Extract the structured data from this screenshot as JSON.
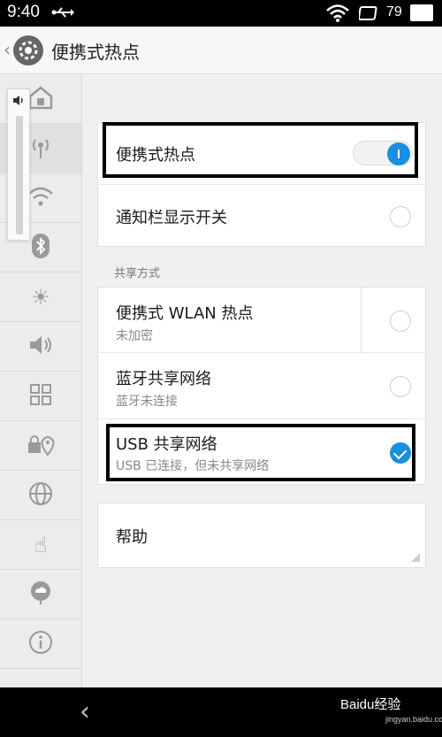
{
  "status_bar": {
    "time": "9:40",
    "battery": "79"
  },
  "header": {
    "title": "便携式热点"
  },
  "sidebar": {
    "items": [
      {
        "icon": "home-icon",
        "glyph": "⌂"
      },
      {
        "icon": "hotspot-icon",
        "glyph": "((·))"
      },
      {
        "icon": "wifi-icon",
        "glyph": "◠"
      },
      {
        "icon": "bluetooth-icon",
        "glyph": "ᛒ"
      },
      {
        "icon": "brightness-icon",
        "glyph": "☀"
      },
      {
        "icon": "sound-icon",
        "glyph": "🔈"
      },
      {
        "icon": "apps-grid-icon",
        "glyph": "▦"
      },
      {
        "icon": "location-lock-icon",
        "glyph": "🔒"
      },
      {
        "icon": "globe-icon",
        "glyph": "🌐"
      },
      {
        "icon": "gesture-hand-icon",
        "glyph": "☝"
      },
      {
        "icon": "cloud-icon",
        "glyph": "☁"
      },
      {
        "icon": "info-icon",
        "glyph": "ⓘ"
      }
    ]
  },
  "main": {
    "hotspot": {
      "label": "便携式热点",
      "enabled": true
    },
    "notify_switch": {
      "label": "通知栏显示开关",
      "checked": false
    },
    "share_section_header": "共享方式",
    "share_options": [
      {
        "label": "便携式 WLAN 热点",
        "subtitle": "未加密",
        "checked": false
      },
      {
        "label": "蓝牙共享网络",
        "subtitle": "蓝牙未连接",
        "checked": false
      },
      {
        "label": "USB 共享网络",
        "subtitle": "USB 已连接，但未共享网络",
        "checked": true
      }
    ],
    "help": {
      "label": "帮助"
    }
  },
  "watermark": {
    "text": "Baidu经验",
    "sub": "jingyan.baidu.com"
  },
  "colors": {
    "accent": "#1a8ee0",
    "highlight_border": "#000000"
  }
}
